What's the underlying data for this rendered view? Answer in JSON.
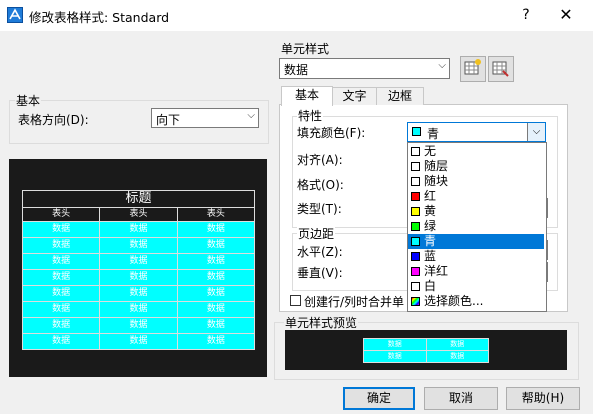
{
  "window": {
    "title": "修改表格样式: Standard",
    "help": "?",
    "close": "✕"
  },
  "basic": {
    "legend": "基本",
    "direction_label": "表格方向(D):",
    "direction_value": "向下"
  },
  "preview": {
    "title": "标题",
    "header": [
      "表头",
      "表头",
      "表头"
    ],
    "data_cell": "数据",
    "rows": 8,
    "cell_color": "#00ffff",
    "grid_color": "#dddddd"
  },
  "cell_style": {
    "label": "单元样式",
    "value": "数据"
  },
  "tabs": [
    {
      "label": "基本"
    },
    {
      "label": "文字"
    },
    {
      "label": "边框"
    }
  ],
  "properties": {
    "legend": "特性",
    "fill_label": "填充颜色(F):",
    "fill_value": "青",
    "fill_color": "#00ffff",
    "align_label": "对齐(A):",
    "format_label": "格式(O):",
    "type_label": "类型(T):"
  },
  "margins": {
    "legend": "页边距",
    "h_label": "水平(Z):",
    "v_label": "垂直(V):"
  },
  "merge_label": "创建行/列时合并单",
  "color_dropdown": [
    {
      "label": "无",
      "color": "#ffffff"
    },
    {
      "label": "随层",
      "color": "#ffffff"
    },
    {
      "label": "随块",
      "color": "#ffffff"
    },
    {
      "label": "红",
      "color": "#ff0000"
    },
    {
      "label": "黄",
      "color": "#ffff00"
    },
    {
      "label": "绿",
      "color": "#00ff00"
    },
    {
      "label": "青",
      "color": "#00ffff"
    },
    {
      "label": "蓝",
      "color": "#0000ff"
    },
    {
      "label": "洋红",
      "color": "#ff00ff"
    },
    {
      "label": "白",
      "color": "#ffffff"
    },
    {
      "label": "选择颜色...",
      "color": "multicolor"
    }
  ],
  "selected_color_index": 6,
  "cell_preview": {
    "legend": "单元样式预览",
    "cell_text": "数据"
  },
  "buttons": {
    "ok": "确定",
    "cancel": "取消",
    "help": "帮助(H)"
  }
}
